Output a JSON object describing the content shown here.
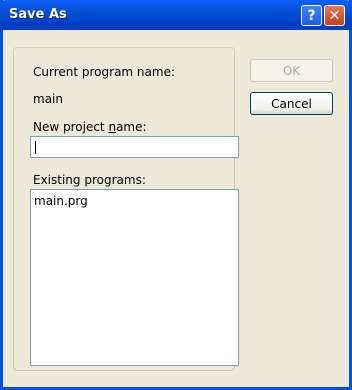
{
  "window": {
    "title": "Save As",
    "help_icon": "?",
    "close_icon": "✕"
  },
  "form": {
    "current_program_label": "Current program name:",
    "current_program_value": "main",
    "new_project_label_pre": "New project ",
    "new_project_label_accel": "n",
    "new_project_label_post": "ame:",
    "new_project_value": "",
    "existing_programs_label": "Existing programs:",
    "existing_programs": [
      "main.prg"
    ]
  },
  "buttons": {
    "ok": "OK",
    "cancel": "Cancel"
  }
}
